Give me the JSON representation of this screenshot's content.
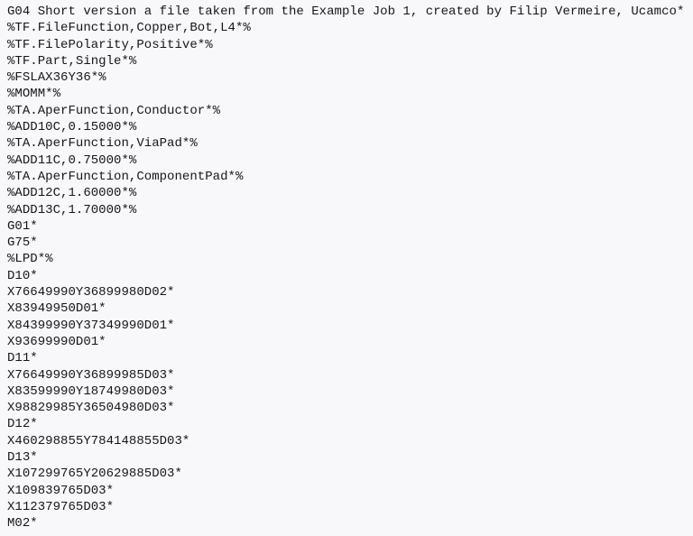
{
  "document": {
    "kind": "gerber-file-listing",
    "format": "RS-274X",
    "background_color": "#f8f8fa",
    "text_color": "#16161a",
    "line_count": 32,
    "lines": [
      "G04 Short version a file taken from the Example Job 1, created by Filip Vermeire, Ucamco*",
      "%TF.FileFunction,Copper,Bot,L4*%",
      "%TF.FilePolarity,Positive*%",
      "%TF.Part,Single*%",
      "%FSLAX36Y36*%",
      "%MOMM*%",
      "%TA.AperFunction,Conductor*%",
      "%ADD10C,0.15000*%",
      "%TA.AperFunction,ViaPad*%",
      "%ADD11C,0.75000*%",
      "%TA.AperFunction,ComponentPad*%",
      "%ADD12C,1.60000*%",
      "%ADD13C,1.70000*%",
      "G01*",
      "G75*",
      "%LPD*%",
      "D10*",
      "X76649990Y36899980D02*",
      "X83949950D01*",
      "X84399990Y37349990D01*",
      "X93699990D01*",
      "D11*",
      "X76649990Y36899985D03*",
      "X83599990Y18749980D03*",
      "X98829985Y36504980D03*",
      "D12*",
      "X460298855Y784148855D03*",
      "D13*",
      "X107299765Y20629885D03*",
      "X109839765D03*",
      "X112379765D03*",
      "M02*"
    ]
  }
}
